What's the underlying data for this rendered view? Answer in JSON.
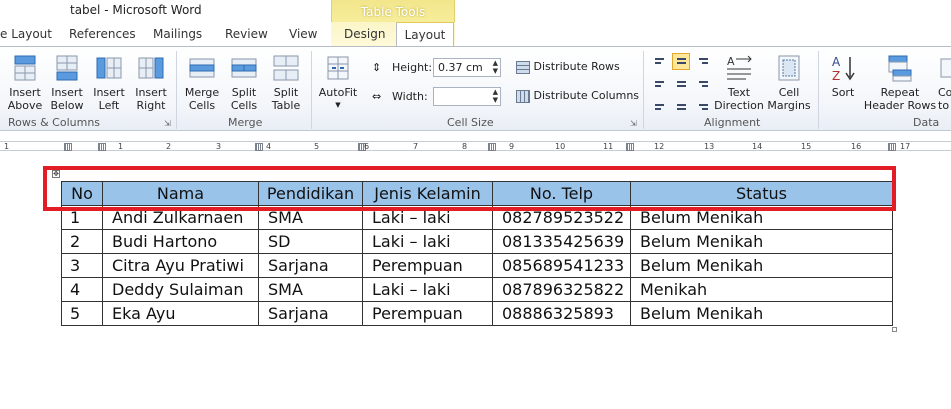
{
  "window": {
    "title": "tabel  -  Microsoft Word",
    "context_tab_group": "Table Tools"
  },
  "tabs": {
    "page_layout": "e Layout",
    "references": "References",
    "mailings": "Mailings",
    "review": "Review",
    "view": "View",
    "design": "Design",
    "layout": "Layout"
  },
  "ribbon": {
    "rows_columns": {
      "label": "Rows & Columns",
      "insert_above": [
        "Insert",
        "Above"
      ],
      "insert_below": [
        "Insert",
        "Below"
      ],
      "insert_left": [
        "Insert",
        "Left"
      ],
      "insert_right": [
        "Insert",
        "Right"
      ]
    },
    "merge": {
      "label": "Merge",
      "merge_cells": [
        "Merge",
        "Cells"
      ],
      "split_cells": [
        "Split",
        "Cells"
      ],
      "split_table": [
        "Split",
        "Table"
      ]
    },
    "cell_size": {
      "label": "Cell Size",
      "autofit": "AutoFit",
      "height_label": "Height:",
      "height_value": "0.37 cm",
      "width_label": "Width:",
      "width_value": "",
      "distribute_rows": "Distribute Rows",
      "distribute_columns": "Distribute Columns"
    },
    "alignment": {
      "label": "Alignment",
      "text_direction": [
        "Text",
        "Direction"
      ],
      "cell_margins": [
        "Cell",
        "Margins"
      ]
    },
    "data": {
      "label": "Data",
      "sort": "Sort",
      "repeat_header_rows": [
        "Repeat",
        "Header Rows"
      ],
      "convert_partial": [
        "Co",
        "to"
      ]
    }
  },
  "ruler": {
    "numbers": [
      "1",
      "1",
      "2",
      "3",
      "4",
      "5",
      "6",
      "7",
      "8",
      "9",
      "10",
      "11",
      "12",
      "13",
      "14",
      "15",
      "16",
      "17"
    ]
  },
  "table": {
    "headers": [
      "No",
      "Nama",
      "Pendidikan",
      "Jenis Kelamin",
      "No. Telp",
      "Status"
    ],
    "rows": [
      [
        "1",
        "Andi Zulkarnaen",
        "SMA",
        "Laki – laki",
        "082789523522",
        "Belum Menikah"
      ],
      [
        "2",
        "Budi Hartono",
        "SD",
        "Laki – laki",
        "081335425639",
        "Belum Menikah"
      ],
      [
        "3",
        "Citra Ayu Pratiwi",
        "Sarjana",
        "Perempuan",
        "085689541233",
        "Belum Menikah"
      ],
      [
        "4",
        "Deddy Sulaiman",
        "SMA",
        "Laki – laki",
        "087896325822",
        "Menikah"
      ],
      [
        "5",
        "Eka Ayu",
        "Sarjana",
        "Perempuan",
        "08886325893",
        "Belum Menikah"
      ]
    ]
  },
  "colors": {
    "header_fill": "#9ac3ea",
    "highlight_border": "#e21d26",
    "context_tab": "#f2e68c"
  }
}
